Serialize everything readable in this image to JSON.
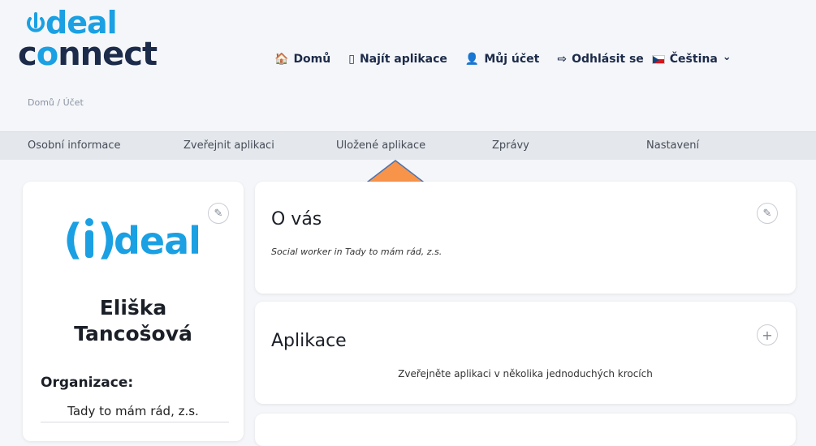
{
  "logo": {
    "top": "deal",
    "bottom_pre": "c",
    "bottom_o": "o",
    "bottom_post": "nnect"
  },
  "nav": {
    "items": [
      {
        "icon": "🏠",
        "label": "Domů"
      },
      {
        "icon": "▯",
        "label": "Najít aplikace"
      },
      {
        "icon": "👤",
        "label": "Můj účet"
      },
      {
        "icon": "⇨",
        "label": "Odhlásit se"
      }
    ],
    "language": {
      "label": "Čeština",
      "chevron": "⌄"
    }
  },
  "breadcrumb": "Domů / Účet",
  "tabs": [
    "Osobní informace",
    "Zveřejnit aplikaci",
    "Uložené aplikace",
    "Zprávy",
    "Nastavení"
  ],
  "profile": {
    "logo_text": "deal",
    "name_first": "Eliška",
    "name_last": "Tancošová",
    "org_label": "Organizace:",
    "org_value": "Tady to mám rád, z.s."
  },
  "about": {
    "title": "O vás",
    "text": "Social worker in Tady to mám rád, z.s."
  },
  "apps": {
    "title": "Aplikace",
    "text": "Zveřejněte aplikaci v několika jednoduchých krocích"
  },
  "colors": {
    "brand_blue": "#1aa0e3",
    "brand_navy": "#1d2b4a",
    "arrow": "#f7944a",
    "arrow_stroke": "#4a73b3"
  }
}
